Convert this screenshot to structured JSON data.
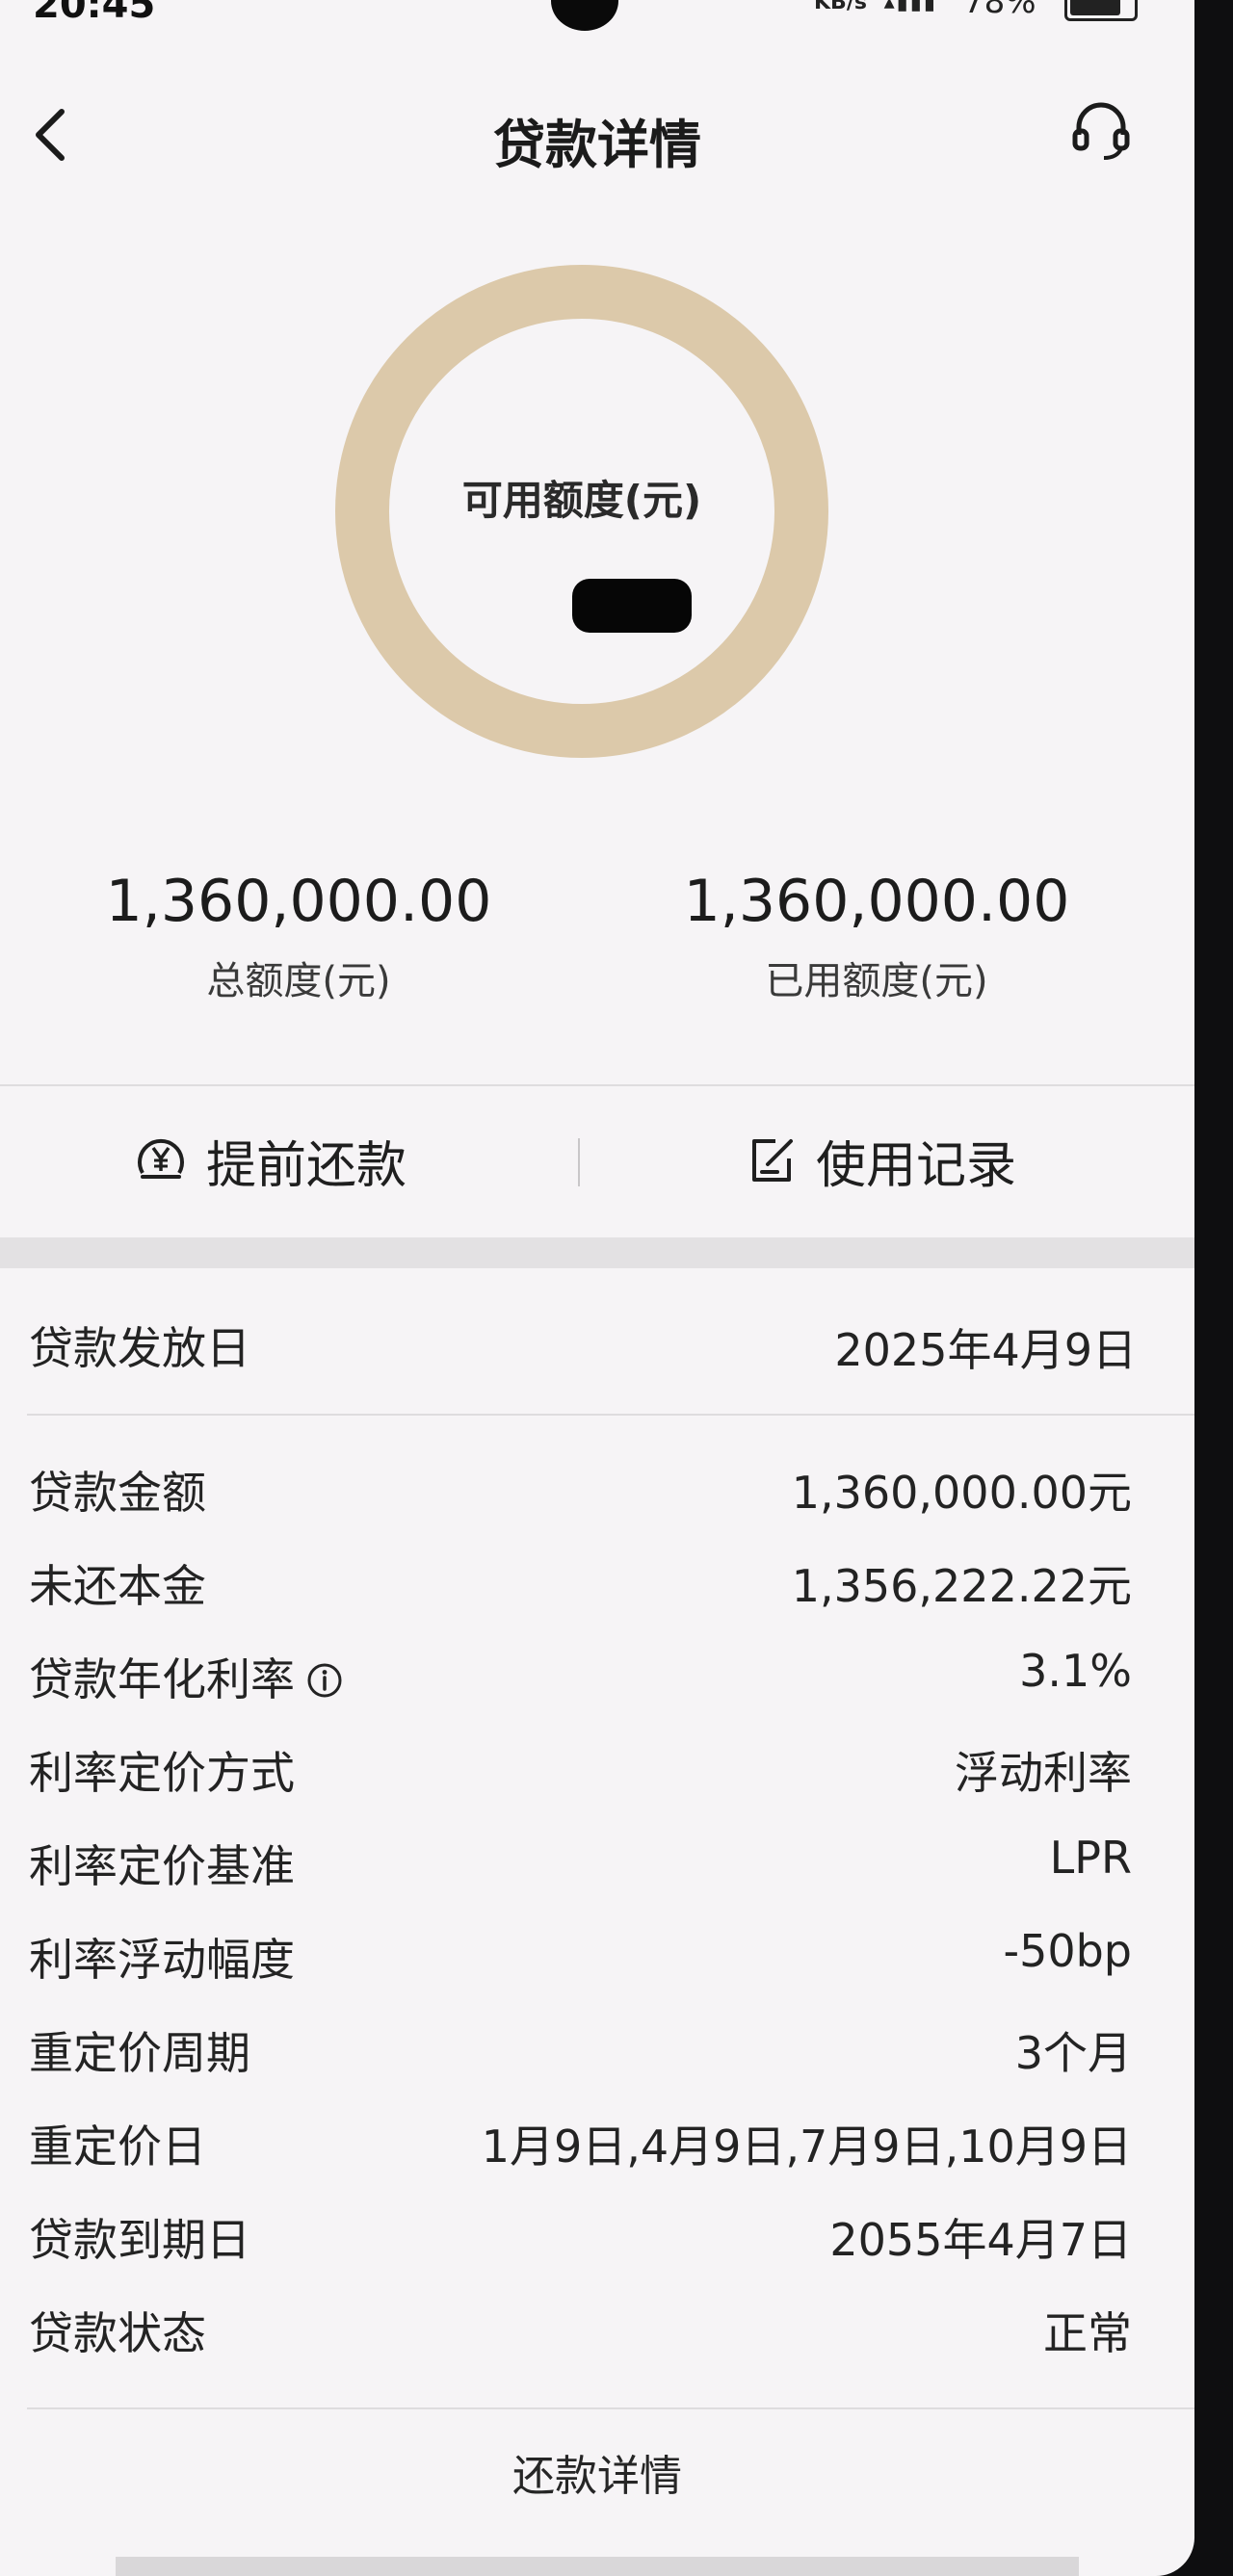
{
  "status_bar": {
    "time": "20:45",
    "net_speed": "KB/s",
    "battery": "78%"
  },
  "header": {
    "title": "贷款详情"
  },
  "ring": {
    "label": "可用额度(元)"
  },
  "totals": {
    "total_amount": "1,360,000.00",
    "total_label": "总额度(元)",
    "used_amount": "1,360,000.00",
    "used_label": "已用额度(元)"
  },
  "actions": {
    "prepay_label": "提前还款",
    "records_label": "使用记录"
  },
  "loan_issue": {
    "label": "贷款发放日",
    "value": "2025年4月9日"
  },
  "details": [
    {
      "label": "贷款金额",
      "value": "1,360,000.00元"
    },
    {
      "label": "未还本金",
      "value": "1,356,222.22元"
    },
    {
      "label": "贷款年化利率",
      "value": "3.1%"
    },
    {
      "label": "利率定价方式",
      "value": "浮动利率"
    },
    {
      "label": "利率定价基准",
      "value": "LPR"
    },
    {
      "label": "利率浮动幅度",
      "value": "-50bp"
    },
    {
      "label": "重定价周期",
      "value": "3个月"
    },
    {
      "label": "重定价日",
      "value": "1月9日,4月9日,7月9日,10月9日"
    },
    {
      "label": "贷款到期日",
      "value": "2055年4月7日"
    },
    {
      "label": "贷款状态",
      "value": "正常"
    }
  ],
  "footer": {
    "repayment_details": "还款详情"
  },
  "colors": {
    "ring": "#dcc9aa",
    "background": "#f6f4f6"
  }
}
